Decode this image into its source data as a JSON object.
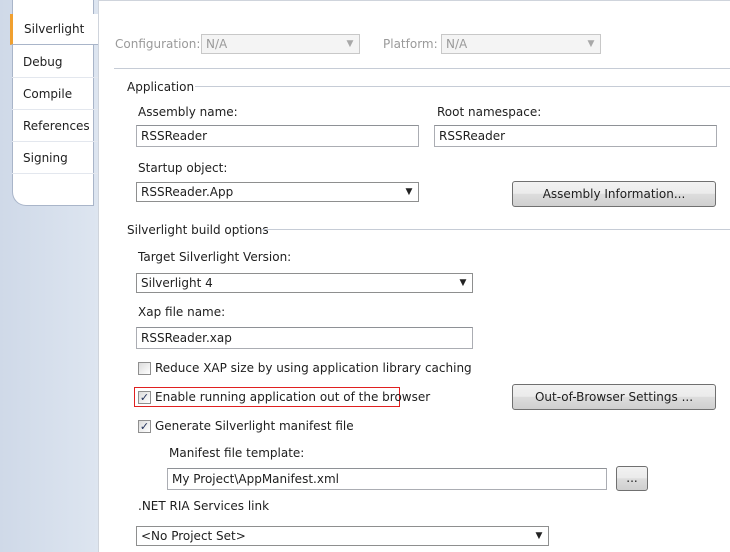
{
  "tabs": [
    {
      "label": "Silverlight",
      "active": true
    },
    {
      "label": "Debug"
    },
    {
      "label": "Compile"
    },
    {
      "label": "References"
    },
    {
      "label": "Signing"
    }
  ],
  "config": {
    "configuration_label": "Configuration:",
    "configuration_value": "N/A",
    "platform_label": "Platform:",
    "platform_value": "N/A"
  },
  "application": {
    "section_label": "Application",
    "assembly_name_label": "Assembly name:",
    "assembly_name_value": "RSSReader",
    "root_namespace_label": "Root namespace:",
    "root_namespace_value": "RSSReader",
    "startup_object_label": "Startup object:",
    "startup_object_value": "RSSReader.App",
    "assembly_info_button": "Assembly Information..."
  },
  "build": {
    "section_label": "Silverlight build options",
    "target_version_label": "Target Silverlight Version:",
    "target_version_value": "Silverlight 4",
    "xap_label": "Xap file name:",
    "xap_value": "RSSReader.xap",
    "reduce_xap_label": "Reduce XAP size by using application library caching",
    "reduce_xap_checked": false,
    "oob_label": "Enable running application out of the browser",
    "oob_checked": true,
    "oob_settings_button": "Out-of-Browser Settings ...",
    "manifest_label": "Generate Silverlight manifest file",
    "manifest_checked": true,
    "manifest_template_label": "Manifest file template:",
    "manifest_template_value": "My Project\\AppManifest.xml",
    "browse_button": "...",
    "ria_label": ".NET RIA Services link",
    "ria_value": "<No Project Set>"
  },
  "colors": {
    "highlight_border": "#e02020",
    "active_tab_accent": "#f0a030"
  },
  "icons": {
    "dropdown": "chevron-down-icon",
    "checkbox": "checkmark-icon"
  }
}
